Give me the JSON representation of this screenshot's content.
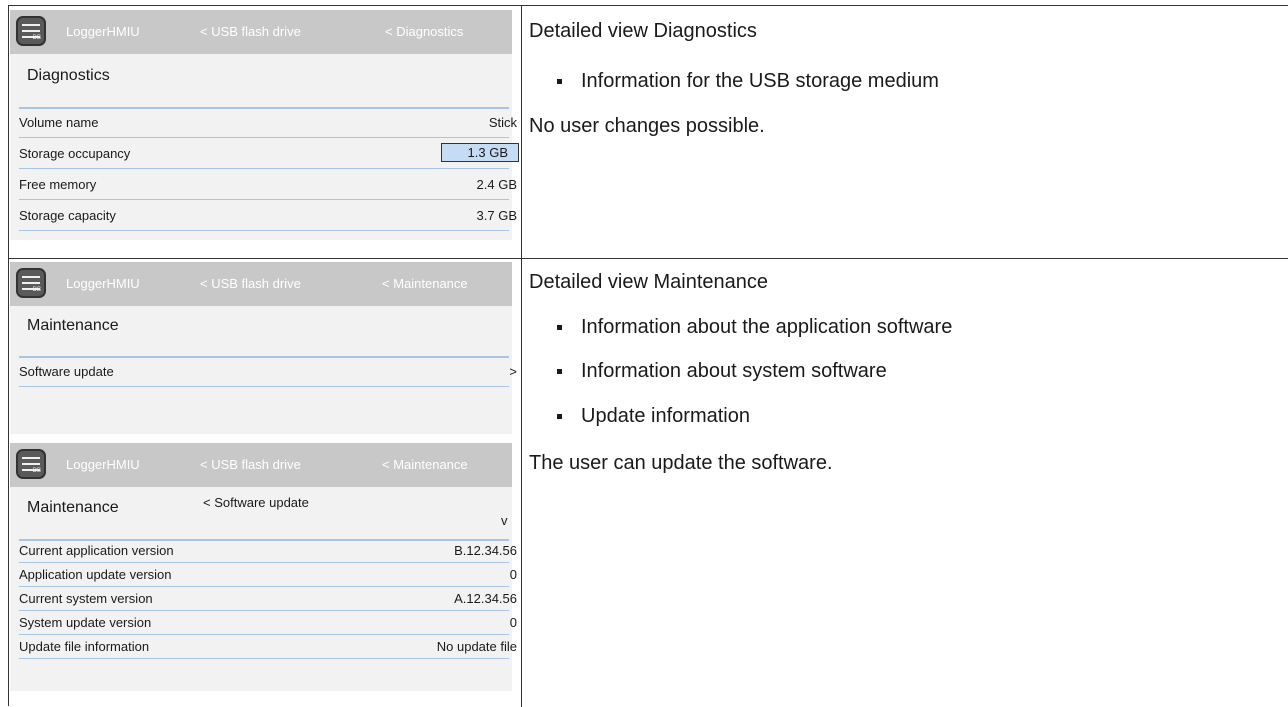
{
  "screen1": {
    "app": "LoggerHMIU",
    "crumb1": "< USB flash drive",
    "crumb2": "< Diagnostics",
    "title": "Diagnostics",
    "rows": [
      {
        "label": "Volume name",
        "value": "Stick"
      },
      {
        "label": "Storage occupancy",
        "value": "1.3 GB"
      },
      {
        "label": "Free memory",
        "value": "2.4 GB"
      },
      {
        "label": "Storage capacity",
        "value": "3.7 GB"
      }
    ]
  },
  "text1": {
    "heading": "Detailed view Diagnostics",
    "bullets": [
      "Information for the USB storage medium"
    ],
    "note": "No user changes possible."
  },
  "screen2": {
    "app": "LoggerHMIU",
    "crumb1": "< USB flash drive",
    "crumb2": "< Maintenance",
    "title": "Maintenance",
    "rows": [
      {
        "label": "Software update",
        "value": ">"
      }
    ]
  },
  "screen3": {
    "app": "LoggerHMIU",
    "crumb1": "< USB flash drive",
    "crumb2": "< Maintenance",
    "title": "Maintenance",
    "subcrumb": "< Software update",
    "chevron": "v",
    "rows": [
      {
        "label": "Current application version",
        "value": "B.12.34.56"
      },
      {
        "label": "Application update version",
        "value": "0"
      },
      {
        "label": "Current system version",
        "value": "A.12.34.56"
      },
      {
        "label": "System update version",
        "value": "0"
      },
      {
        "label": "Update file information",
        "value": "No update file"
      }
    ]
  },
  "text2": {
    "heading": "Detailed view Maintenance",
    "bullets": [
      "Information about the application software",
      "Information about system software",
      "Update information"
    ],
    "note": "The user can update the software."
  },
  "colors": {
    "header": "#c8c8c8",
    "panel": "#f2f2f2",
    "row_line": "#a9c5e4",
    "highlight": "#c6dcf4"
  },
  "icons": {
    "app_icon": "logger-db-icon"
  }
}
